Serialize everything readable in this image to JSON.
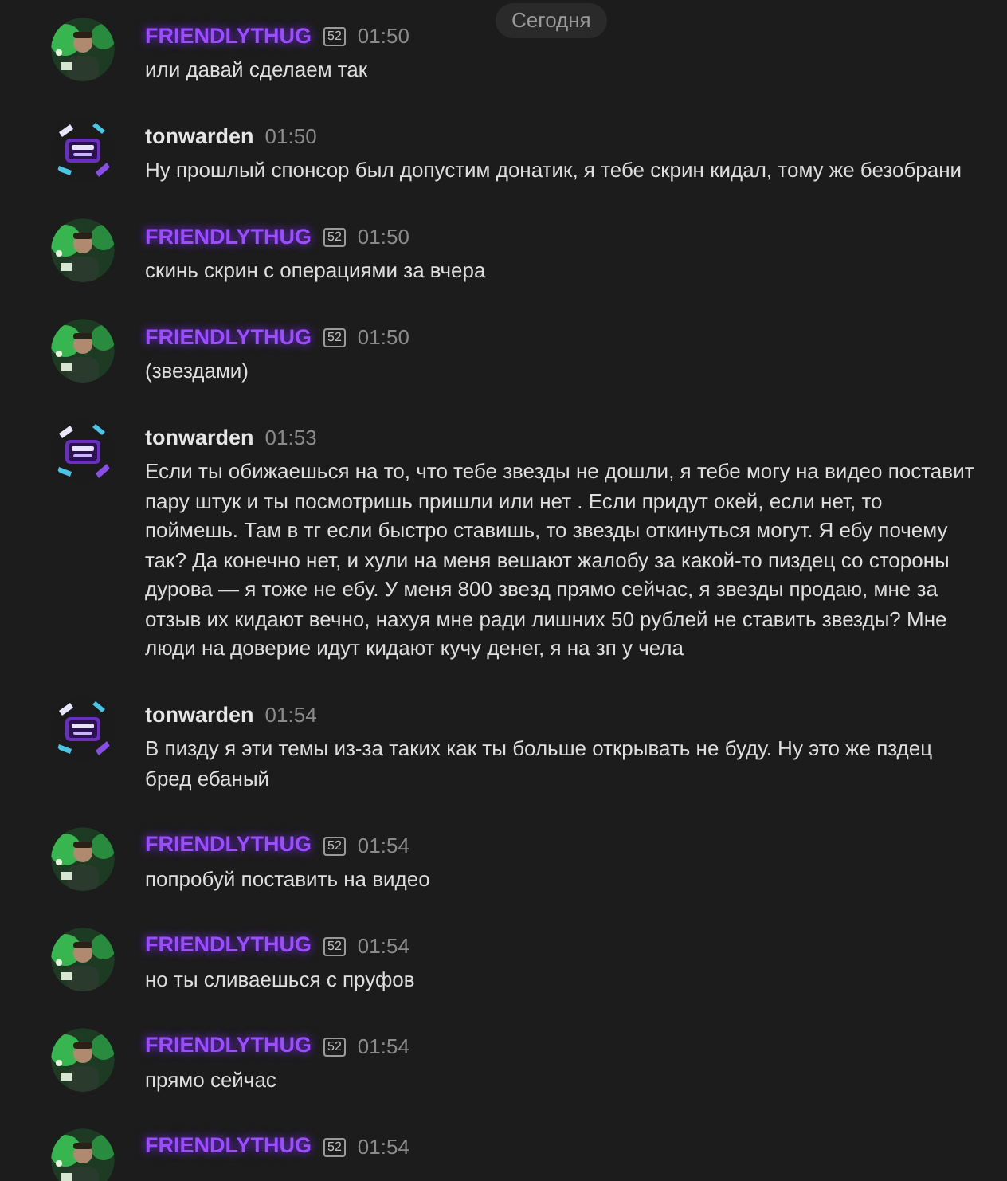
{
  "date_divider": "Сегодня",
  "messages": [
    {
      "author": "FRIENDLYTHUG",
      "highlighted": true,
      "badge": "52",
      "time": "01:50",
      "lines": [
        "или давай сделаем так"
      ]
    },
    {
      "author": "tonwarden",
      "highlighted": false,
      "kind": "logo",
      "time": "01:50",
      "lines": [
        "Ну прошлый спонсор был допустим донатик, я тебе скрин кидал, тому же безобрани"
      ]
    },
    {
      "author": "FRIENDLYTHUG",
      "highlighted": true,
      "badge": "52",
      "time": "01:50",
      "lines": [
        "скинь скрин с операциями за вчера"
      ]
    },
    {
      "author": "FRIENDLYTHUG",
      "highlighted": true,
      "badge": "52",
      "time": "01:50",
      "lines": [
        "(звездами)"
      ]
    },
    {
      "author": "tonwarden",
      "highlighted": false,
      "kind": "logo",
      "time": "01:53",
      "lines": [
        "Если ты обижаешься на то, что тебе звезды не дошли, я тебе могу на видео поставит",
        "пару штук и ты посмотришь пришли или нет . Если придут окей, если нет, то",
        "поймешь. Там в тг если быстро ставишь, то звезды откинуться могут. Я ебу почему",
        "так? Да конечно нет, и хули на меня вешают жалобу за какой-то пиздец со стороны",
        "дурова — я тоже не ебу. У меня 800 звезд прямо сейчас, я звезды продаю, мне за",
        "отзыв их кидают вечно, нахуя мне ради лишних 50 рублей не ставить звезды? Мне",
        "люди на доверие идут кидают кучу денег, я на зп у чела"
      ]
    },
    {
      "author": "tonwarden",
      "highlighted": false,
      "kind": "logo",
      "time": "01:54",
      "lines": [
        "В пизду я эти темы из-за таких как ты больше открывать не буду. Ну это же пздец",
        "бред ебаный"
      ]
    },
    {
      "author": "FRIENDLYTHUG",
      "highlighted": true,
      "badge": "52",
      "time": "01:54",
      "lines": [
        "попробуй поставить на видео"
      ]
    },
    {
      "author": "FRIENDLYTHUG",
      "highlighted": true,
      "badge": "52",
      "time": "01:54",
      "lines": [
        "но ты сливаешься с пруфов"
      ]
    },
    {
      "author": "FRIENDLYTHUG",
      "highlighted": true,
      "badge": "52",
      "time": "01:54",
      "lines": [
        "прямо сейчас"
      ]
    },
    {
      "author": "FRIENDLYTHUG",
      "highlighted": true,
      "badge": "52",
      "time": "01:54"
    }
  ]
}
